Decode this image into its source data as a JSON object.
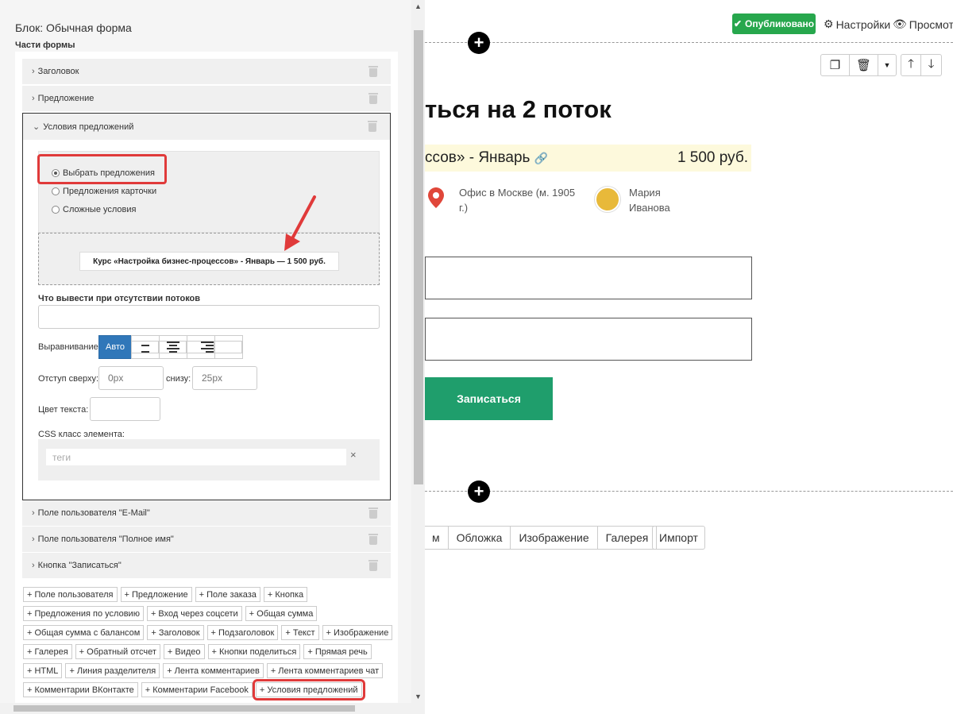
{
  "page": {
    "published_label": "Опубликовано",
    "settings_label": "Настройки",
    "preview_label": "Просмотр",
    "heading": "ться на 2 поток",
    "offer_text": "ссов» - Январь",
    "offer_price": "1 500 руб.",
    "location": "Офис в Москве (м. 1905 г.)",
    "person": "Мария Иванова",
    "submit_label": "Записаться",
    "tabs": [
      "м",
      "Обложка",
      "Изображение",
      "Галерея"
    ],
    "import_label": "Импорт"
  },
  "panel": {
    "title": "Блок: Обычная форма",
    "parts_label": "Части формы",
    "items_top": [
      "Заголовок",
      "Предложение"
    ],
    "open_item": "Условия предложений",
    "radios": [
      "Выбрать предложения",
      "Предложения карточки",
      "Сложные условия"
    ],
    "selected_radio": "Выбрать предложения",
    "course_chip": "Курс «Настройка бизнес-процессов» - Январь — 1 500 руб.",
    "no_streams_label": "Что вывести при отсутствии потоков",
    "align_label": "Выравнивание",
    "align_auto": "Авто",
    "margin_top_label": "Отступ сверху:",
    "margin_top_placeholder": "0px",
    "margin_bottom_label": "снизу:",
    "margin_bottom_placeholder": "25px",
    "text_color_label": "Цвет текста:",
    "css_label": "CSS класс элемента:",
    "tags_placeholder": "теги",
    "items_bottom": [
      "Поле пользователя \"E-Mail\"",
      "Поле пользователя \"Полное имя\"",
      "Кнопка \"Записаться\""
    ],
    "chips": [
      [
        "+ Поле пользователя",
        "+ Предложение",
        "+ Поле заказа",
        "+ Кнопка"
      ],
      [
        "+ Предложения по условию",
        "+ Вход через соцсети",
        "+ Общая сумма"
      ],
      [
        "+ Общая сумма с балансом",
        "+ Заголовок",
        "+ Подзаголовок",
        "+ Текст",
        "+ Изображение"
      ],
      [
        "+ Галерея",
        "+ Обратный отсчет",
        "+ Видео",
        "+ Кнопки поделиться",
        "+ Прямая речь"
      ],
      [
        "+ HTML",
        "+ Линия разделителя",
        "+ Лента комментариев",
        "+ Лента комментариев чат"
      ],
      [
        "+ Комментарии ВКонтакте",
        "+ Комментарии Facebook",
        "+ Условия предложений"
      ]
    ],
    "highlighted_chip": "+ Условия предложений"
  },
  "colors": {
    "accent_green": "#27a74d",
    "submit_green": "#1f9e6c",
    "highlight_red": "#e03a3a",
    "align_active": "#3077b9"
  }
}
